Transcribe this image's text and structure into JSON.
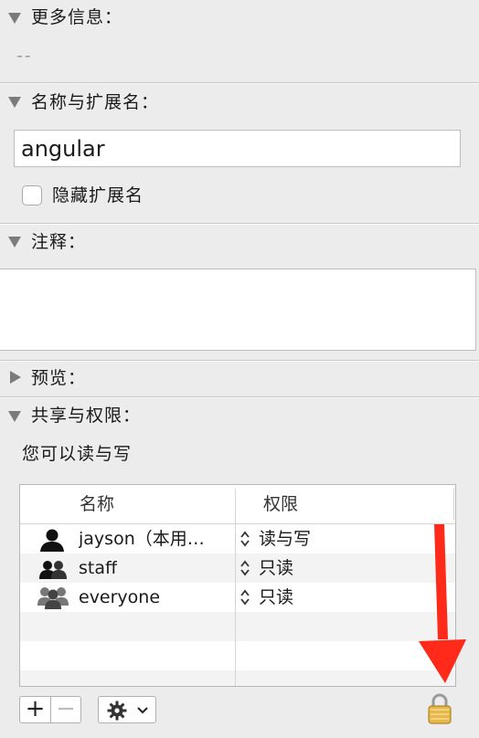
{
  "sections": {
    "more_info": {
      "title": "更多信息：",
      "value": "--"
    },
    "name_ext": {
      "title": "名称与扩展名：",
      "name_value": "angular",
      "hide_ext_label": "隐藏扩展名",
      "hide_ext_checked": false
    },
    "comments": {
      "title": "注释：",
      "value": ""
    },
    "preview": {
      "title": "预览："
    },
    "sharing": {
      "title": "共享与权限：",
      "summary": "您可以读与写"
    }
  },
  "permissions_table": {
    "columns": [
      "名称",
      "权限"
    ],
    "rows": [
      {
        "name": "jayson（本用…",
        "privilege": "读与写",
        "icon": "single-user-icon"
      },
      {
        "name": "staff",
        "privilege": "只读",
        "icon": "group-users-icon"
      },
      {
        "name": "everyone",
        "privilege": "只读",
        "icon": "everyone-users-icon"
      }
    ]
  },
  "toolbar": {
    "add": "+",
    "remove": "−",
    "action_icon": "gear-icon",
    "lock_icon": "lock-icon"
  },
  "annotation": {
    "arrow_color": "#ff2a1a"
  }
}
